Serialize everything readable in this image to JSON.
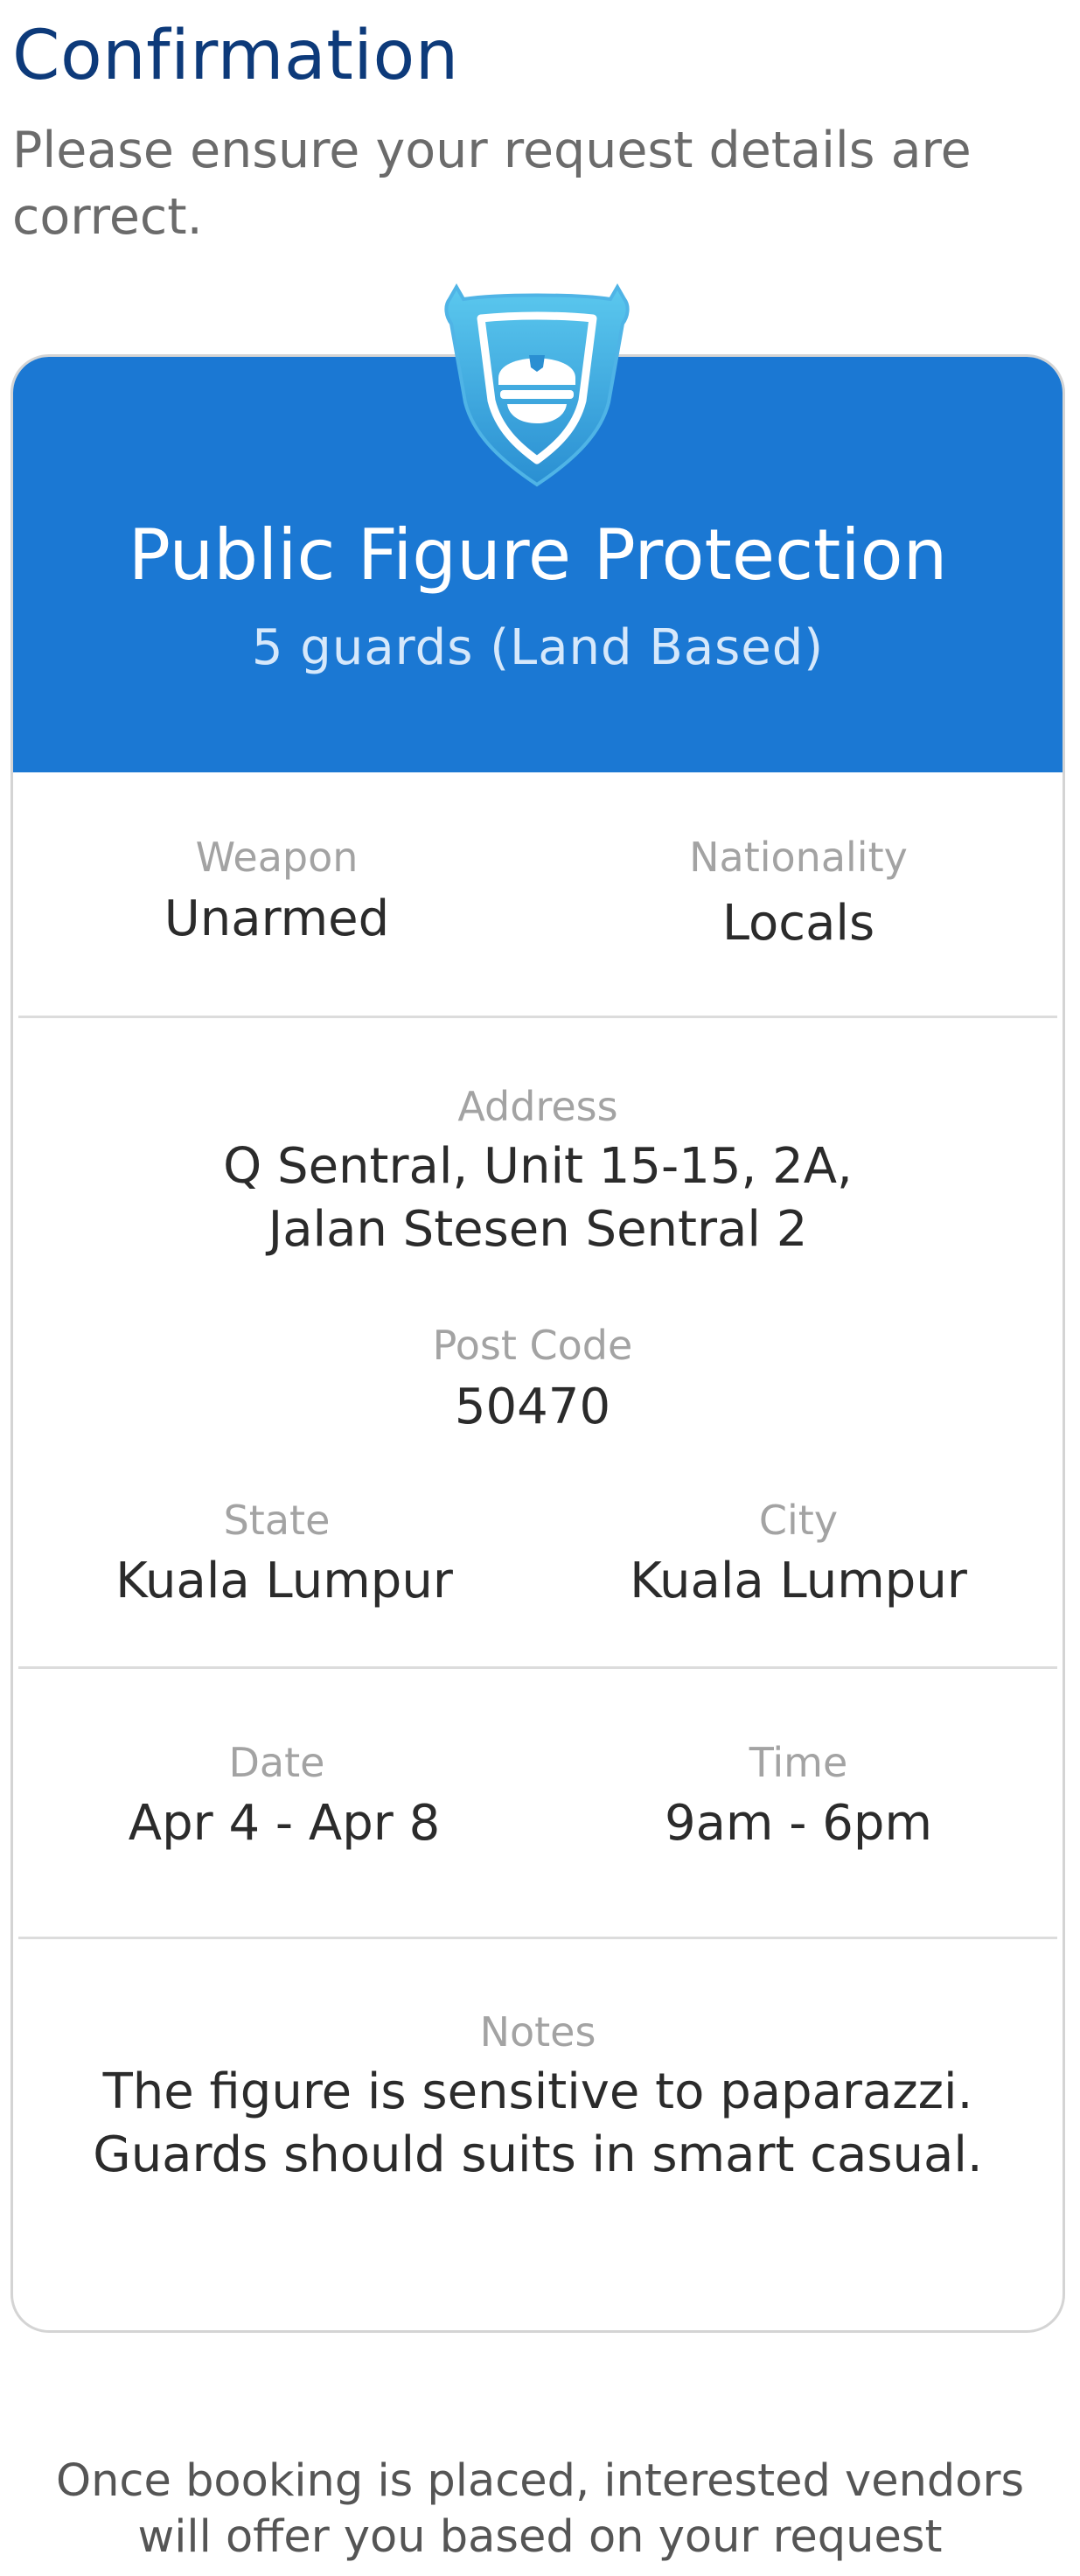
{
  "header": {
    "title": "Confirmation",
    "subtitle": "Please ensure your request details are correct."
  },
  "service": {
    "icon": "security-guard-badge-icon",
    "title": "Public Figure Protection",
    "subtitle": "5 guards (Land Based)"
  },
  "details": {
    "weapon": {
      "label": "Weapon",
      "value": "Unarmed"
    },
    "nationality": {
      "label": "Nationality",
      "value": "Locals"
    },
    "address": {
      "label": "Address",
      "line1": "Q Sentral, Unit 15-15, 2A,",
      "line2": "Jalan Stesen Sentral 2"
    },
    "postcode": {
      "label": "Post Code",
      "value": "50470"
    },
    "state": {
      "label": "State",
      "value": "Kuala Lumpur"
    },
    "city": {
      "label": "City",
      "value": "Kuala Lumpur"
    },
    "date": {
      "label": "Date",
      "value": "Apr 4 - Apr 8"
    },
    "time": {
      "label": "Time",
      "value": "9am - 6pm"
    },
    "notes": {
      "label": "Notes",
      "line1": "The figure is sensitive to paparazzi.",
      "line2": "Guards should suits in smart casual."
    }
  },
  "footer": {
    "line1": "Once booking is placed, interested vendors",
    "line2": "will offer you based on your request"
  },
  "colors": {
    "title": "#0d3a7a",
    "header_bg": "#1b78d3",
    "badge_light": "#5bc3ea",
    "badge_dark": "#2a94d4"
  }
}
